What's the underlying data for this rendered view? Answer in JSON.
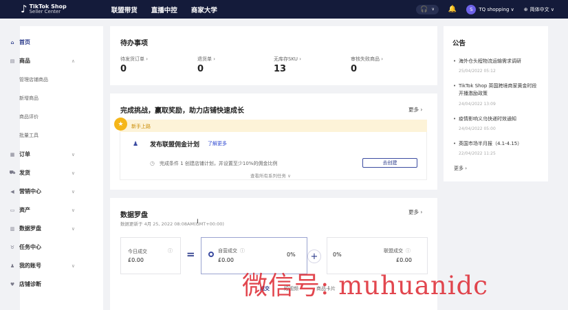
{
  "header": {
    "logo_name": "TikTok Shop",
    "logo_sub": "Seller Center",
    "nav": [
      "联盟带货",
      "直播中控",
      "商家大学"
    ],
    "shop_name": "TQ shopping ∨",
    "language": "简体中文 ∨",
    "avatar_letter": "S"
  },
  "sidebar": {
    "items": [
      {
        "label": "首页",
        "icon": "home-icon"
      },
      {
        "label": "商品",
        "icon": "product-icon"
      },
      {
        "label": "订单",
        "icon": "order-icon"
      },
      {
        "label": "发货",
        "icon": "shipping-icon"
      },
      {
        "label": "营销中心",
        "icon": "marketing-icon"
      },
      {
        "label": "资产",
        "icon": "assets-icon"
      },
      {
        "label": "数据罗盘",
        "icon": "chart-icon"
      },
      {
        "label": "任务中心",
        "icon": "task-icon"
      },
      {
        "label": "我的账号",
        "icon": "account-icon"
      },
      {
        "label": "店铺诊断",
        "icon": "diagnosis-icon"
      }
    ],
    "sub_items": [
      "管理店铺商品",
      "新增商品",
      "商品评价",
      "批量工具"
    ]
  },
  "todo": {
    "title": "待办事项",
    "items": [
      {
        "label": "待发货订单 ›",
        "value": "0"
      },
      {
        "label": "退货单 ›",
        "value": "0"
      },
      {
        "label": "无库存SKU ›",
        "value": "13"
      },
      {
        "label": "审核失败商品 ›",
        "value": "0"
      }
    ]
  },
  "challenge": {
    "title": "完成挑战，赢取奖励，助力店铺快速成长",
    "more": "更多 ›",
    "new_label": "新手上路",
    "task_title": "发布联盟佣金计划",
    "task_link": "了解更多",
    "condition": "完成条件 1  创建店铺计划，并设置至少10%的佣金比例",
    "button": "去创建",
    "view_all": "查看所有系列任务 ∨"
  },
  "compass": {
    "title": "数据罗盘",
    "more": "更多 ›",
    "updated": "数据更新于 4月 25, 2022 08:08AM(GMT+00:00)",
    "boxes": [
      {
        "label": "今日成交",
        "value": "£0.00"
      },
      {
        "label": "自营成交",
        "value": "£0.00",
        "percent": "0%"
      },
      {
        "label": "联盟成交",
        "value": "£0.00",
        "percent": "0%"
      }
    ],
    "equals": "=",
    "plus": "+",
    "tabs": [
      "成交",
      "短视频",
      "商品卡片"
    ]
  },
  "notice": {
    "title": "公告",
    "items": [
      {
        "text": "海外仓头程物流运输需求调研",
        "date": "25/04/2022 05:12"
      },
      {
        "text": "TikTok Shop 英国跨境商家黄金时段开播激励政策",
        "date": "24/04/2022 13:09"
      },
      {
        "text": "疫情影响义乌快递时效通知",
        "date": "24/04/2022 05:00"
      },
      {
        "text": "英国市场半月报（4.1-4.15）",
        "date": "22/04/2022 11:25"
      }
    ],
    "more": "更多 ›"
  },
  "watermark": "微信号: muhuanidc",
  "colors": {
    "topbar": "#141b3a",
    "accent": "#2a3a8a",
    "newbar": "#fdf3d8",
    "watermark": "#dc1e28"
  }
}
